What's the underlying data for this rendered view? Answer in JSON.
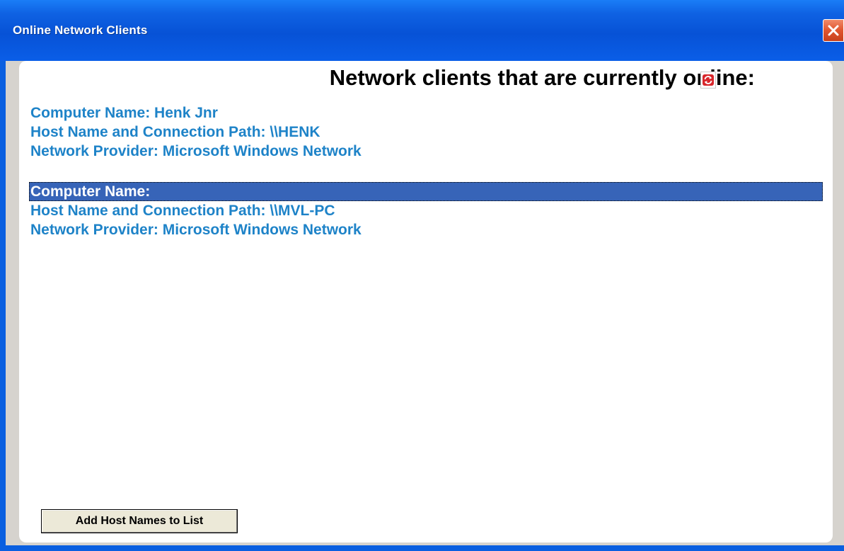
{
  "window": {
    "title": "Online Network Clients",
    "close_icon": "close-icon"
  },
  "main": {
    "heading": "Network clients that are currently online:",
    "refresh_icon": "refresh-icon"
  },
  "clients": [
    {
      "computer_name": "Computer Name: Henk Jnr",
      "host_path": "Host Name and Connection Path: \\\\HENK",
      "provider": "Network Provider: Microsoft Windows Network",
      "selected": false
    },
    {
      "computer_name": "Computer Name:",
      "host_path": "Host Name and Connection Path: \\\\MVL-PC",
      "provider": "Network Provider: Microsoft Windows Network",
      "selected": true
    }
  ],
  "buttons": {
    "add_hosts_label": "Add Host Names to List"
  },
  "colors": {
    "title_bar": "#0a5fe0",
    "client_text": "#1e83c8",
    "selection": "#3764b8"
  }
}
